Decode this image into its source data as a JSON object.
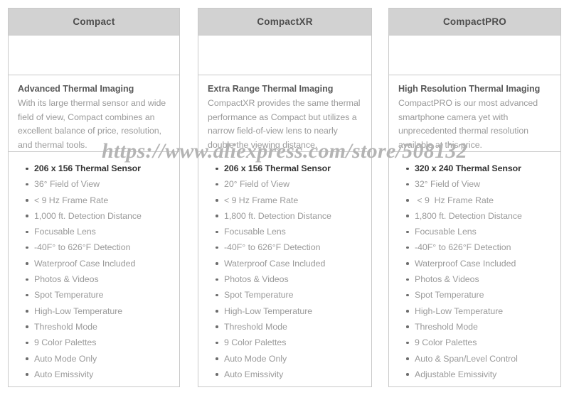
{
  "watermark": "https://www.aliexpress.com/store/508132",
  "columns": [
    {
      "header": "Compact",
      "desc_title": "Advanced Thermal Imaging",
      "desc_body": "With its large thermal sensor and wide field of view, Compact combines an excellent balance of price, resolution, and thermal tools.",
      "specs": [
        "206 x 156 Thermal Sensor",
        "36° Field of View",
        "< 9 Hz Frame Rate",
        "1,000 ft. Detection Distance",
        "Focusable Lens",
        "-40F° to 626°F Detection",
        "Waterproof Case Included",
        "Photos & Videos",
        "Spot Temperature",
        "High-Low Temperature",
        "Threshold Mode",
        "9 Color Palettes",
        "Auto Mode Only",
        "Auto Emissivity"
      ]
    },
    {
      "header": "CompactXR",
      "desc_title": "Extra Range Thermal Imaging",
      "desc_body": "CompactXR provides the same thermal performance as Compact but utilizes a narrow field-of-view lens to nearly double the viewing distance.",
      "specs": [
        "206 x 156 Thermal Sensor",
        "20° Field of View",
        "< 9 Hz Frame Rate",
        "1,800 ft. Detection Distance",
        "Focusable Lens",
        "-40F° to 626°F Detection",
        "Waterproof Case Included",
        "Photos & Videos",
        "Spot Temperature",
        "High-Low Temperature",
        "Threshold Mode",
        "9 Color Palettes",
        "Auto Mode Only",
        "Auto Emissivity"
      ]
    },
    {
      "header": "CompactPRO",
      "desc_title": "High Resolution Thermal Imaging",
      "desc_body": "CompactPRO is our most advanced smartphone camera yet with unprecedented thermal resolution available at this price.",
      "specs": [
        "320 x 240 Thermal Sensor",
        "32° Field of View",
        " < 9  Hz Frame Rate",
        "1,800 ft. Detection Distance",
        "Focusable Lens",
        "-40F° to 626°F Detection",
        "Waterproof Case Included",
        "Photos & Videos",
        "Spot Temperature",
        "High-Low Temperature",
        "Threshold Mode",
        "9 Color Palettes",
        "Auto & Span/Level Control",
        "Adjustable Emissivity"
      ]
    }
  ],
  "colors": {
    "header_bg": "#d2d2d2",
    "border": "#c9c9c9",
    "body_text": "#9a9a9a",
    "title_text": "#595959",
    "watermark": "#b4b4b4"
  }
}
